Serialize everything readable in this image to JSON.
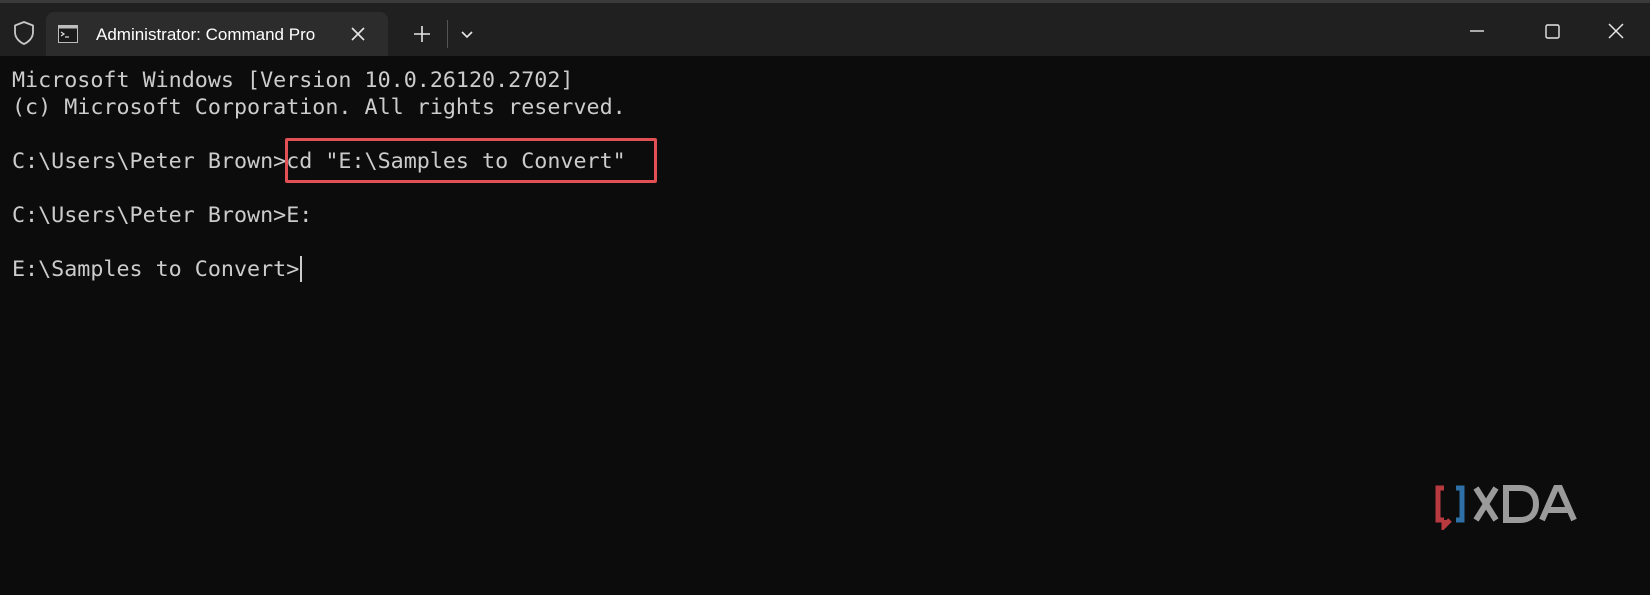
{
  "window": {
    "tab_title": "Administrator: Command Pro",
    "icons": {
      "shield": "shield-icon",
      "tab": "command-prompt-icon",
      "close_tab": "close-icon",
      "new_tab": "plus-icon",
      "dropdown": "chevron-down-icon",
      "minimize": "minimize-icon",
      "maximize": "maximize-icon",
      "close_window": "close-icon"
    }
  },
  "terminal": {
    "lines": [
      "Microsoft Windows [Version 10.0.26120.2702]",
      "(c) Microsoft Corporation. All rights reserved.",
      "C:\\Users\\Peter Brown>cd \"E:\\Samples to Convert\"",
      "C:\\Users\\Peter Brown>E:",
      "E:\\Samples to Convert>"
    ],
    "highlighted_command": "cd \"E:\\Samples to Convert\"",
    "highlight_color": "#e05054",
    "text_color": "#cccccc",
    "background": "#0c0c0c"
  },
  "watermark": {
    "text": "XDA",
    "bracket_left_color": "#b83a3f",
    "bracket_right_color": "#2e6fa8"
  }
}
